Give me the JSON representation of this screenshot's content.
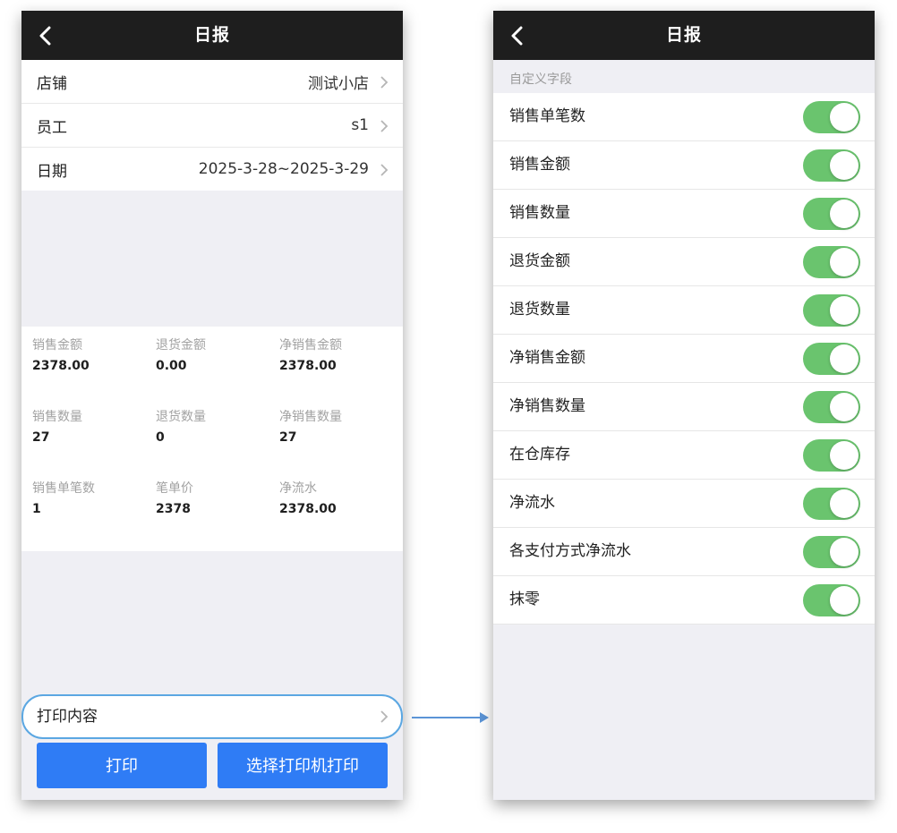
{
  "left": {
    "title": "日报",
    "rows": [
      {
        "label": "店铺",
        "value": "测试小店"
      },
      {
        "label": "员工",
        "value": "s1"
      },
      {
        "label": "日期",
        "value": "2025-3-28~2025-3-29"
      }
    ],
    "stats": [
      {
        "label": "销售金额",
        "value": "2378.00"
      },
      {
        "label": "退货金额",
        "value": "0.00"
      },
      {
        "label": "净销售金额",
        "value": "2378.00"
      },
      {
        "label": "销售数量",
        "value": "27"
      },
      {
        "label": "退货数量",
        "value": "0"
      },
      {
        "label": "净销售数量",
        "value": "27"
      },
      {
        "label": "销售单笔数",
        "value": "1"
      },
      {
        "label": "笔单价",
        "value": "2378"
      },
      {
        "label": "净流水",
        "value": "2378.00"
      }
    ],
    "print_content_label": "打印内容",
    "print_button": "打印",
    "select_printer_button": "选择打印机打印"
  },
  "right": {
    "title": "日报",
    "section_header": "自定义字段",
    "toggles": [
      {
        "label": "销售单笔数",
        "on": true
      },
      {
        "label": "销售金额",
        "on": true
      },
      {
        "label": "销售数量",
        "on": true
      },
      {
        "label": "退货金额",
        "on": true
      },
      {
        "label": "退货数量",
        "on": true
      },
      {
        "label": "净销售金额",
        "on": true
      },
      {
        "label": "净销售数量",
        "on": true
      },
      {
        "label": "在仓库存",
        "on": true
      },
      {
        "label": "净流水",
        "on": true
      },
      {
        "label": "各支付方式净流水",
        "on": true
      },
      {
        "label": "抹零",
        "on": true
      }
    ]
  },
  "colors": {
    "navbar": "#1e1e1e",
    "primary_button": "#2f7cf5",
    "switch_on": "#6ac46e",
    "highlight_border": "#5ba7e2"
  },
  "icons": {
    "back": "back-icon",
    "chevron": "chevron-right-icon",
    "arrow": "arrow-right-icon"
  }
}
